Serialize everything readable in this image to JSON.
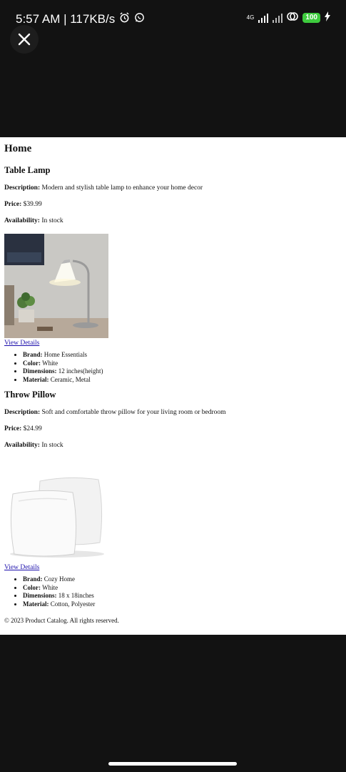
{
  "status_bar": {
    "time_speed": "5:57 AM | 117KB/s",
    "network": "4G",
    "battery": "100"
  },
  "page": {
    "heading": "Home",
    "products": [
      {
        "title": "Table Lamp",
        "description_label": "Description:",
        "description": "Modern and stylish table lamp to enhance your home decor",
        "price_label": "Price:",
        "price": "$39.99",
        "availability_label": "Availability:",
        "availability": "In stock",
        "link": "View Details",
        "specs": [
          {
            "label": "Brand:",
            "value": "Home Essentials"
          },
          {
            "label": "Color:",
            "value": "White"
          },
          {
            "label": "Dimensions:",
            "value": "12 inches(height)"
          },
          {
            "label": "Material:",
            "value": "Ceramic, Metal"
          }
        ]
      },
      {
        "title": "Throw Pillow",
        "description_label": "Description:",
        "description": "Soft and comfortable throw pillow for your living room or bedroom",
        "price_label": "Price:",
        "price": "$24.99",
        "availability_label": "Availability:",
        "availability": "In stock",
        "link": "View Details",
        "specs": [
          {
            "label": "Brand:",
            "value": "Cozy Home"
          },
          {
            "label": "Color:",
            "value": "White"
          },
          {
            "label": "Dimensions:",
            "value": "18 x 18inches"
          },
          {
            "label": "Material:",
            "value": "Cotton, Polyester"
          }
        ]
      }
    ],
    "footer": "© 2023 Product Catalog. All rights reserved."
  }
}
